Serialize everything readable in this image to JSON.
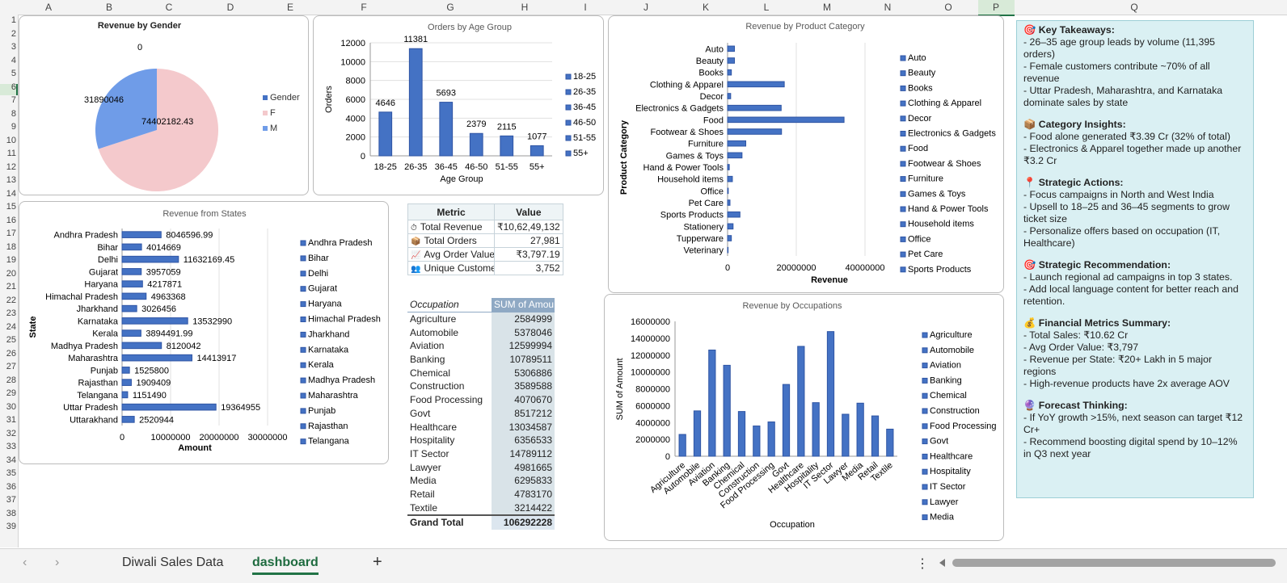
{
  "columns": [
    "A",
    "B",
    "C",
    "D",
    "E",
    "F",
    "G",
    "H",
    "I",
    "J",
    "K",
    "L",
    "M",
    "N",
    "O",
    "P",
    "Q"
  ],
  "rows": [
    "1",
    "2",
    "3",
    "4",
    "5",
    "6",
    "7",
    "8",
    "9",
    "10",
    "11",
    "12",
    "13",
    "14",
    "15",
    "16",
    "17",
    "18",
    "19",
    "20",
    "21",
    "22",
    "23",
    "24",
    "25",
    "26",
    "27",
    "28",
    "29",
    "30",
    "31",
    "32",
    "33",
    "34",
    "35",
    "36",
    "37",
    "38",
    "39"
  ],
  "gender_chart": {
    "title": "Revenue by Gender",
    "labels": [
      "0",
      "31890046",
      "74402182.43"
    ],
    "legend": [
      "Gender",
      "F",
      "M"
    ],
    "colors": {
      "F": "#f4c9cc",
      "M": "#6f9ce8",
      "Gender": "#4472c4"
    }
  },
  "chart_data": [
    {
      "type": "pie",
      "title": "Revenue by Gender",
      "categories": [
        "Gender",
        "F",
        "M"
      ],
      "values": [
        0,
        74402182.43,
        31890046
      ]
    },
    {
      "type": "bar",
      "title": "Orders by Age Group",
      "xlabel": "Age Group",
      "ylabel": "Orders",
      "categories": [
        "18-25",
        "26-35",
        "36-45",
        "46-50",
        "51-55",
        "55+"
      ],
      "values": [
        4646,
        11381,
        5693,
        2379,
        2115,
        1077
      ],
      "ylim": [
        0,
        12000
      ],
      "yticks": [
        "0",
        "2000",
        "4000",
        "6000",
        "8000",
        "10000",
        "12000"
      ],
      "legend": [
        "18-25",
        "26-35",
        "36-45",
        "46-50",
        "51-55",
        "55+"
      ]
    },
    {
      "type": "bar",
      "orientation": "horizontal",
      "title": "Revenue from States",
      "xlabel": "Amount",
      "ylabel": "State",
      "categories": [
        "Andhra Pradesh",
        "Bihar",
        "Delhi",
        "Gujarat",
        "Haryana",
        "Himachal Pradesh",
        "Jharkhand",
        "Karnataka",
        "Kerala",
        "Madhya Pradesh",
        "Maharashtra",
        "Punjab",
        "Rajasthan",
        "Telangana",
        "Uttar Pradesh",
        "Uttarakhand"
      ],
      "values": [
        8046596.99,
        4014669,
        11632169.45,
        3957059,
        4217871,
        4963368,
        3026456,
        13532990,
        3894491.99,
        8120042,
        14413917,
        1525800,
        1909409,
        1151490,
        19364955,
        2520944
      ],
      "labels": [
        "8046596.99",
        "4014669",
        "11632169.45",
        "3957059",
        "4217871",
        "4963368",
        "3026456",
        "13532990",
        "3894491.99",
        "8120042",
        "14413917",
        "1525800",
        "1909409",
        "1151490",
        "19364955",
        "2520944"
      ],
      "xlim": [
        0,
        30000000
      ],
      "xticks": [
        "0",
        "10000000",
        "20000000",
        "30000000"
      ],
      "legend": [
        "Andhra Pradesh",
        "Bihar",
        "Delhi",
        "Gujarat",
        "Haryana",
        "Himachal Pradesh",
        "Jharkhand",
        "Karnataka",
        "Kerala",
        "Madhya Pradesh",
        "Maharashtra",
        "Punjab",
        "Rajasthan",
        "Telangana"
      ]
    },
    {
      "type": "bar",
      "orientation": "horizontal",
      "title": "Revenue by Product Category",
      "xlabel": "Revenue",
      "ylabel": "Product Category",
      "categories": [
        "Auto",
        "Beauty",
        "Books",
        "Clothing & Apparel",
        "Decor",
        "Electronics & Gadgets",
        "Food",
        "Footwear & Shoes",
        "Furniture",
        "Games & Toys",
        "Hand & Power Tools",
        "Household items",
        "Office",
        "Pet Care",
        "Sports Products",
        "Stationery",
        "Tupperware",
        "Veterinary"
      ],
      "values": [
        2000000,
        2000000,
        1100000,
        16500000,
        900000,
        15600000,
        33900000,
        15700000,
        5300000,
        4200000,
        500000,
        1400000,
        200000,
        700000,
        3600000,
        1600000,
        1100000,
        150000
      ],
      "xlim": [
        0,
        40000000
      ],
      "xticks": [
        "0",
        "20000000",
        "40000000"
      ],
      "legend": [
        "Auto",
        "Beauty",
        "Books",
        "Clothing & Apparel",
        "Decor",
        "Electronics & Gadgets",
        "Food",
        "Footwear & Shoes",
        "Furniture",
        "Games & Toys",
        "Hand & Power Tools",
        "Household items",
        "Office",
        "Pet Care",
        "Sports Products"
      ]
    },
    {
      "type": "bar",
      "title": "Revenue by Occupations",
      "xlabel": "Occupation",
      "ylabel": "SUM of Amount",
      "categories": [
        "Agriculture",
        "Automobile",
        "Aviation",
        "Banking",
        "Chemical",
        "Construction",
        "Food Processing",
        "Govt",
        "Healthcare",
        "Hospitality",
        "IT Sector",
        "Lawyer",
        "Media",
        "Retail",
        "Textile"
      ],
      "values": [
        2584999,
        5378046,
        12599994,
        10789511,
        5306886,
        3589588,
        4070670,
        8517212,
        13034587,
        6356533,
        14789112,
        4981665,
        6295833,
        4783170,
        3214422
      ],
      "ylim": [
        0,
        16000000
      ],
      "yticks": [
        "0",
        "2000000",
        "4000000",
        "6000000",
        "8000000",
        "10000000",
        "12000000",
        "14000000",
        "16000000"
      ],
      "legend": [
        "Agriculture",
        "Automobile",
        "Aviation",
        "Banking",
        "Chemical",
        "Construction",
        "Food Processing",
        "Govt",
        "Healthcare",
        "Hospitality",
        "IT Sector",
        "Lawyer",
        "Media"
      ]
    }
  ],
  "metric_table": {
    "headers": [
      "Metric",
      "Value"
    ],
    "rows": [
      {
        "icon": "⏱",
        "metric": "Total Revenue",
        "value": "₹10,62,49,132"
      },
      {
        "icon": "📦",
        "metric": "Total Orders",
        "value": "27,981"
      },
      {
        "icon": "📈",
        "metric": "Avg Order Value",
        "value": "₹3,797.19"
      },
      {
        "icon": "👥",
        "metric": "Unique Customer",
        "value": "3,752"
      }
    ]
  },
  "occupation_table": {
    "headers": [
      "Occupation",
      "SUM of Amou"
    ],
    "rows": [
      [
        "Agriculture",
        "2584999"
      ],
      [
        "Automobile",
        "5378046"
      ],
      [
        "Aviation",
        "12599994"
      ],
      [
        "Banking",
        "10789511"
      ],
      [
        "Chemical",
        "5306886"
      ],
      [
        "Construction",
        "3589588"
      ],
      [
        "Food Processing",
        "4070670"
      ],
      [
        "Govt",
        "8517212"
      ],
      [
        "Healthcare",
        "13034587"
      ],
      [
        "Hospitality",
        "6356533"
      ],
      [
        "IT Sector",
        "14789112"
      ],
      [
        "Lawyer",
        "4981665"
      ],
      [
        "Media",
        "6295833"
      ],
      [
        "Retail",
        "4783170"
      ],
      [
        "Textile",
        "3214422"
      ]
    ],
    "total_label": "Grand Total",
    "total_value": "106292228"
  },
  "notes": [
    {
      "title": "🎯 Key Takeaways:",
      "lines": [
        "- 26–35 age group leads by volume (11,395 orders)",
        "- Female customers contribute ~70% of all revenue",
        "- Uttar Pradesh, Maharashtra, and Karnataka dominate sales by state"
      ]
    },
    {
      "title": "📦 Category Insights:",
      "lines": [
        "- Food alone generated ₹3.39 Cr (32% of total)",
        "- Electronics & Apparel together made up another ₹3.2 Cr"
      ]
    },
    {
      "title": "📍 Strategic Actions:",
      "lines": [
        "- Focus campaigns in North and West India",
        "- Upsell to 18–25 and 36–45 segments to grow ticket size",
        "- Personalize offers based on occupation (IT, Healthcare)"
      ]
    },
    {
      "title": "🎯 Strategic Recommendation:",
      "lines": [
        "- Launch regional ad campaigns in top 3 states.",
        "- Add local language content for better reach and retention."
      ]
    },
    {
      "title": "💰 Financial Metrics Summary:",
      "lines": [
        "- Total Sales: ₹10.62 Cr",
        "- Avg Order Value: ₹3,797",
        "- Revenue per State: ₹20+ Lakh in 5 major regions",
        "- High-revenue products have 2x average AOV"
      ]
    },
    {
      "title": "🔮 Forecast Thinking:",
      "lines": [
        "- If YoY growth >15%, next season can target ₹12 Cr+",
        "- Recommend boosting digital spend by 10–12% in Q3 next year"
      ]
    }
  ],
  "sheet_tabs": {
    "tab1": "Diwali Sales Data",
    "tab2": "dashboard",
    "add": "+",
    "prev": "‹",
    "next": "›",
    "more": "⋮"
  },
  "colors": {
    "bar": "#4472c4",
    "bar_dark": "#2f55a4",
    "accent": "#217346"
  }
}
